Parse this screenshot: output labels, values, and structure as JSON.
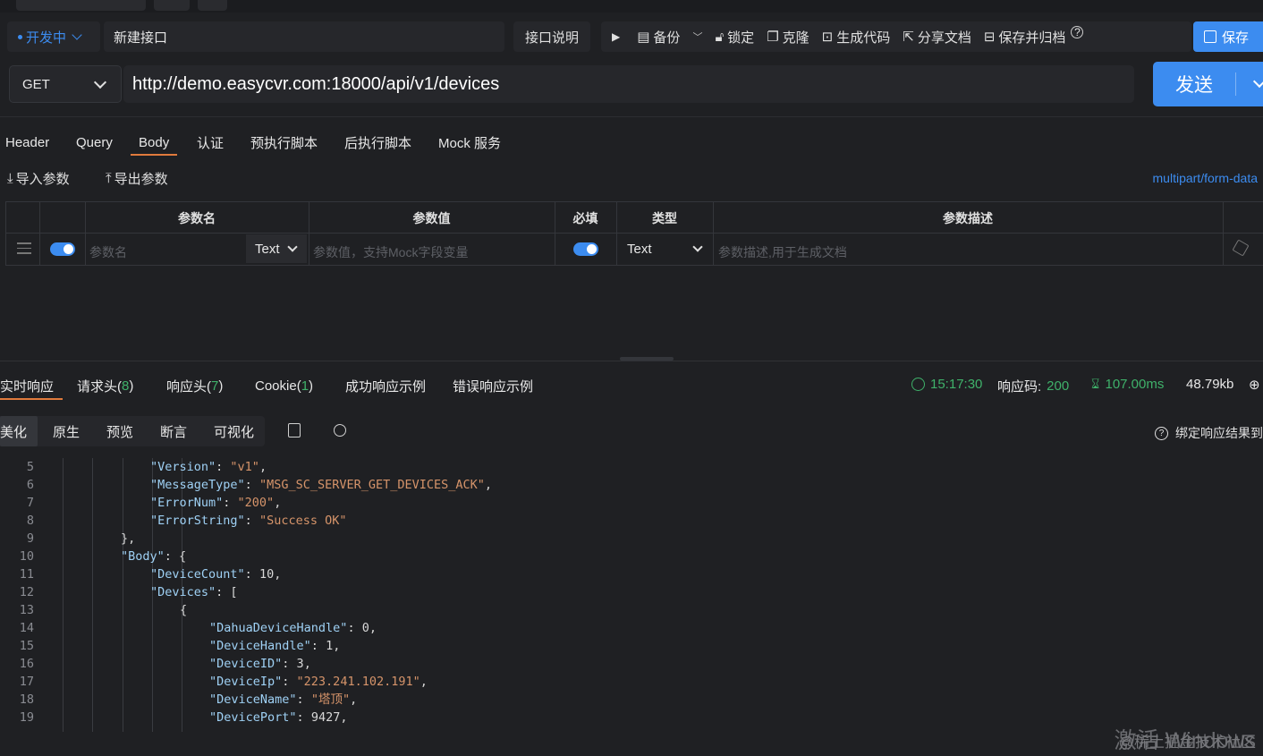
{
  "header": {
    "env_label": "开发中",
    "api_name": "新建接口",
    "doc_button": "接口说明",
    "toolbar": [
      {
        "icon": "play-icon",
        "label": ""
      },
      {
        "icon": "backup-icon",
        "label": "备份"
      },
      {
        "icon": "lock-icon",
        "label": "锁定"
      },
      {
        "icon": "clone-icon",
        "label": "克隆"
      },
      {
        "icon": "code-icon",
        "label": "生成代码"
      },
      {
        "icon": "share-icon",
        "label": "分享文档"
      },
      {
        "icon": "archive-icon",
        "label": "保存并归档"
      }
    ],
    "save_label": "保存"
  },
  "request": {
    "method": "GET",
    "url": "http://demo.easycvr.com:18000/api/v1/devices",
    "send_label": "发送",
    "tabs": [
      "Header",
      "Query",
      "Body",
      "认证",
      "预执行脚本",
      "后执行脚本",
      "Mock 服务"
    ],
    "active_tab": "Body",
    "import_label": "导入参数",
    "export_label": "导出参数",
    "body_type": "multipart/form-data",
    "table": {
      "headers": [
        "参数名",
        "参数值",
        "必填",
        "类型",
        "参数描述"
      ],
      "row": {
        "name_placeholder": "参数名",
        "name_type": "Text",
        "value_placeholder": "参数值，支持Mock字段变量",
        "type": "Text",
        "desc_placeholder": "参数描述,用于生成文档"
      }
    }
  },
  "response": {
    "tabs": [
      {
        "label": "实时响应",
        "count": ""
      },
      {
        "label": "请求头(",
        "count": "8"
      },
      {
        "label": "响应头(",
        "count": "7"
      },
      {
        "label": "Cookie(",
        "count": "1"
      },
      {
        "label": "成功响应示例",
        "count": ""
      },
      {
        "label": "错误响应示例",
        "count": ""
      }
    ],
    "time": "15:17:30",
    "status_label": "响应码:",
    "status_code": "200",
    "duration": "107.00ms",
    "size": "48.79kb",
    "view_tabs": [
      "美化",
      "原生",
      "预览",
      "断言",
      "可视化"
    ],
    "bind_label": "绑定响应结果到",
    "code_lines": [
      {
        "no": "5",
        "indent": 4,
        "key": "\"Version\"",
        "sep": ": ",
        "val": "\"v1\"",
        "vtype": "s",
        "tail": ","
      },
      {
        "no": "6",
        "indent": 4,
        "key": "\"MessageType\"",
        "sep": ": ",
        "val": "\"MSG_SC_SERVER_GET_DEVICES_ACK\"",
        "vtype": "s",
        "tail": ","
      },
      {
        "no": "7",
        "indent": 4,
        "key": "\"ErrorNum\"",
        "sep": ": ",
        "val": "\"200\"",
        "vtype": "s",
        "tail": ","
      },
      {
        "no": "8",
        "indent": 4,
        "key": "\"ErrorString\"",
        "sep": ": ",
        "val": "\"Success OK\"",
        "vtype": "s",
        "tail": ""
      },
      {
        "no": "9",
        "indent": 3,
        "key": "",
        "sep": "",
        "val": "",
        "vtype": "n",
        "tail": "},"
      },
      {
        "no": "10",
        "indent": 3,
        "key": "\"Body\"",
        "sep": ": ",
        "val": "",
        "vtype": "n",
        "tail": "{"
      },
      {
        "no": "11",
        "indent": 4,
        "key": "\"DeviceCount\"",
        "sep": ": ",
        "val": "10",
        "vtype": "n",
        "tail": ","
      },
      {
        "no": "12",
        "indent": 4,
        "key": "\"Devices\"",
        "sep": ": ",
        "val": "",
        "vtype": "n",
        "tail": "["
      },
      {
        "no": "13",
        "indent": 5,
        "key": "",
        "sep": "",
        "val": "",
        "vtype": "n",
        "tail": "{"
      },
      {
        "no": "14",
        "indent": 6,
        "key": "\"DahuaDeviceHandle\"",
        "sep": ": ",
        "val": "0",
        "vtype": "n",
        "tail": ","
      },
      {
        "no": "15",
        "indent": 6,
        "key": "\"DeviceHandle\"",
        "sep": ": ",
        "val": "1",
        "vtype": "n",
        "tail": ","
      },
      {
        "no": "16",
        "indent": 6,
        "key": "\"DeviceID\"",
        "sep": ": ",
        "val": "3",
        "vtype": "n",
        "tail": ","
      },
      {
        "no": "17",
        "indent": 6,
        "key": "\"DeviceIp\"",
        "sep": ": ",
        "val": "\"223.241.102.191\"",
        "vtype": "s",
        "tail": ","
      },
      {
        "no": "18",
        "indent": 6,
        "key": "\"DeviceName\"",
        "sep": ": ",
        "val": "\"塔顶\"",
        "vtype": "s",
        "tail": ","
      },
      {
        "no": "19",
        "indent": 6,
        "key": "\"DevicePort\"",
        "sep": ": ",
        "val": "9427",
        "vtype": "n",
        "tail": ","
      }
    ]
  },
  "watermark": {
    "activate_text": "激活 Windows",
    "site_text": "@稀土掘金技术社区"
  },
  "colors": {
    "accent": "#3c8cf0",
    "active_tab_underline": "#e07a3c",
    "success": "#3fb16a",
    "json_key": "#9fd1f5",
    "json_string": "#d6946a"
  }
}
